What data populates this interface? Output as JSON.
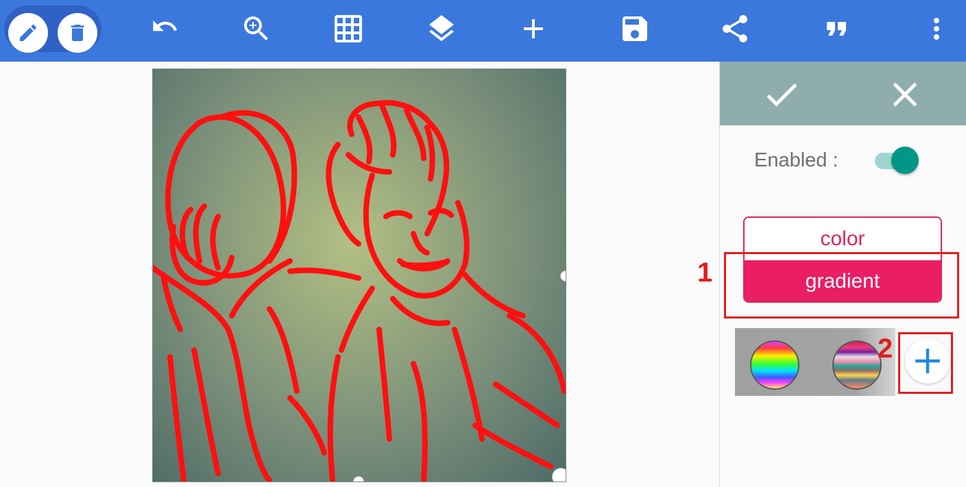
{
  "toolbar": {
    "icons": [
      "pencil-icon",
      "trash-icon",
      "undo-icon",
      "zoom-in-icon",
      "grid-icon",
      "layers-icon",
      "add-icon",
      "save-icon",
      "share-icon",
      "quote-icon",
      "more-vert-icon"
    ],
    "bar_color": "#3b78de"
  },
  "panel": {
    "confirm_icon": "check-icon",
    "cancel_icon": "close-icon",
    "enabled_label": "Enabled :",
    "enabled": true,
    "mode_options": [
      "color",
      "gradient"
    ],
    "selected_mode": "gradient",
    "accent_color": "#e91e63",
    "toggle_color": "#009688",
    "gradient_presets": [
      "rainbow-gradient-swatch",
      "multicolor-stripes-gradient-swatch"
    ],
    "add_gradient_icon": "plus-icon"
  },
  "annotations": {
    "label_1": "1",
    "label_2": "2",
    "color": "#e11d1d"
  }
}
